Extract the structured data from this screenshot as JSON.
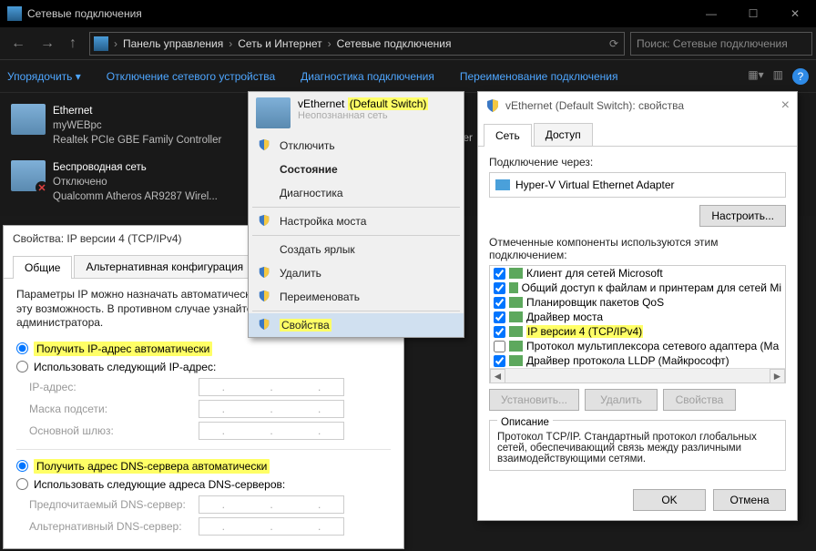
{
  "window": {
    "title": "Сетевые подключения"
  },
  "winbuttons": {
    "min": "—",
    "max": "☐",
    "close": "✕"
  },
  "nav": {
    "back": "←",
    "forward": "→",
    "up": "↑",
    "refresh": "⟳"
  },
  "breadcrumb": {
    "seg1": "Панель управления",
    "seg2": "Сеть и Интернет",
    "seg3": "Сетевые подключения",
    "chev": "›"
  },
  "search": {
    "placeholder": "Поиск: Сетевые подключения"
  },
  "cmdbar": {
    "organize": "Упорядочить ▾",
    "disable": "Отключение сетевого устройства",
    "diag": "Диагностика подключения",
    "rename": "Переименование подключения",
    "help": "?"
  },
  "conns": {
    "ethernet": {
      "name": "Ethernet",
      "sub1": "myWEBpc",
      "sub2": "Realtek PCIe GBE Family Controller"
    },
    "wifi": {
      "name": "Беспроводная сеть",
      "sub1": "Отключено",
      "sub2": "Qualcomm Atheros AR9287 Wirel..."
    },
    "veth": {
      "name": "vEthernet",
      "highlight": "(Default Switch)",
      "sub": "Неопознанная сеть"
    },
    "hidden": {
      "sub2": "pter"
    }
  },
  "ctx": {
    "disable": "Отключить",
    "state": "Состояние",
    "diag": "Диагностика",
    "bridge": "Настройка моста",
    "shortcut": "Создать ярлык",
    "delete": "Удалить",
    "rename": "Переименовать",
    "props": "Свойства"
  },
  "props": {
    "title": "vEthernet (Default Switch): свойства",
    "tab_net": "Сеть",
    "tab_access": "Доступ",
    "connect_via": "Подключение через:",
    "adapter": "Hyper-V Virtual Ethernet Adapter",
    "configure": "Настроить...",
    "components_label": "Отмеченные компоненты используются этим подключением:",
    "comp1": "Клиент для сетей Microsoft",
    "comp2": "Общий доступ к файлам и принтерам для сетей Mi",
    "comp3": "Планировщик пакетов QoS",
    "comp4": "Драйвер моста",
    "comp5": "IP версии 4 (TCP/IPv4)",
    "comp6": "Протокол мультиплексора сетевого адаптера (Ма",
    "comp7": "Драйвер протокола LLDP (Майкрософт)",
    "install": "Установить...",
    "remove": "Удалить",
    "properties": "Свойства",
    "desc_label": "Описание",
    "desc": "Протокол TCP/IP. Стандартный протокол глобальных сетей, обеспечивающий связь между различными взаимодействующими сетями.",
    "ok": "OK",
    "cancel": "Отмена"
  },
  "ipv4": {
    "title": "Свойства: IP версии 4 (TCP/IPv4)",
    "tab_general": "Общие",
    "tab_alt": "Альтернативная конфигурация",
    "explain": "Параметры IP можно назначать автоматически, если сеть поддерживает эту возможность. В противном случае узнайте параметры IP у сетевого администратора.",
    "auto_ip": "Получить IP-адрес автоматически",
    "manual_ip": "Использовать следующий IP-адрес:",
    "ip_addr": "IP-адрес:",
    "mask": "Маска подсети:",
    "gateway": "Основной шлюз:",
    "auto_dns": "Получить адрес DNS-сервера автоматически",
    "manual_dns": "Использовать следующие адреса DNS-серверов:",
    "pref_dns": "Предпочитаемый DNS-сервер:",
    "alt_dns": "Альтернативный DNS-сервер:"
  }
}
